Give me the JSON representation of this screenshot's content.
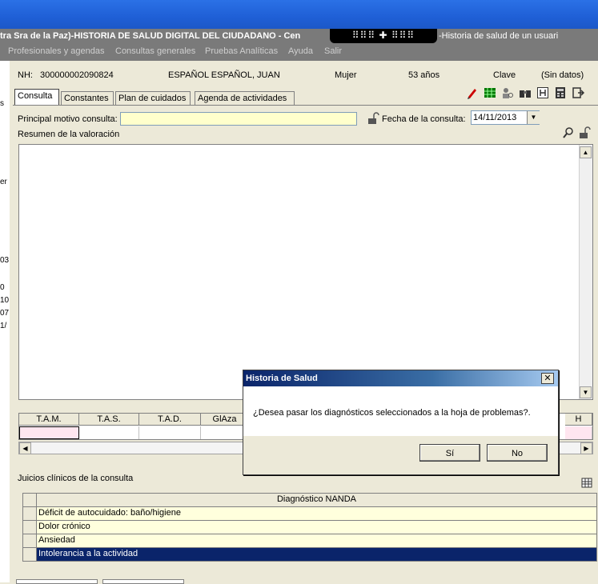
{
  "window": {
    "title": "tra Sra de la Paz)-HISTORIA DE SALUD DIGITAL  DEL CIUDADANO - Cen",
    "title_right": "-Historia de salud de un usuari",
    "remote_bar": "⠿⠿⠿ ✚ ⠿⠿⠿"
  },
  "menu": [
    "Profesionales y agendas",
    "Consultas generales",
    "Pruebas Analíticas",
    "Ayuda",
    "Salir"
  ],
  "left_stub": [
    "s",
    "er",
    "03",
    "0",
    "10",
    "07",
    "1/"
  ],
  "patient": {
    "nh_label": "NH:",
    "nh": "300000002090824",
    "name": "ESPAÑOL ESPAÑOL, JUAN",
    "sex": "Mujer",
    "age": "53 años",
    "clave_label": "Clave",
    "clave": "(Sin datos)"
  },
  "tabs": [
    "Consulta",
    "Constantes",
    "Plan de cuidados",
    "Agenda de actividades"
  ],
  "form": {
    "motivo_label": "Principal motivo consulta:",
    "motivo_value": "",
    "fecha_label": "Fecha de la consulta:",
    "fecha_value": "14/11/2013",
    "resumen_label": "Resumen de la valoración"
  },
  "constants_columns": [
    "T.A.M.",
    "T.A.S.",
    "T.A.D.",
    "GlAza",
    "H"
  ],
  "juicios": {
    "label": "Juicios clínicos de la consulta",
    "header": "Diagnóstico NANDA",
    "rows": [
      "Déficit de autocuidado: baño/higiene",
      "Dolor crónico",
      "Ansiedad",
      "Intolerancia a la actividad"
    ]
  },
  "dialog": {
    "title": "Historia de Salud",
    "close": "✕",
    "message": "¿Desea pasar los diagnósticos seleccionados a la hoja de problemas?.",
    "yes": "Sí",
    "no": "No"
  },
  "colors": {
    "highlight_row": "#0a246a",
    "input_yellow": "#ffffcc",
    "nanda_row": "#ffffdd"
  }
}
